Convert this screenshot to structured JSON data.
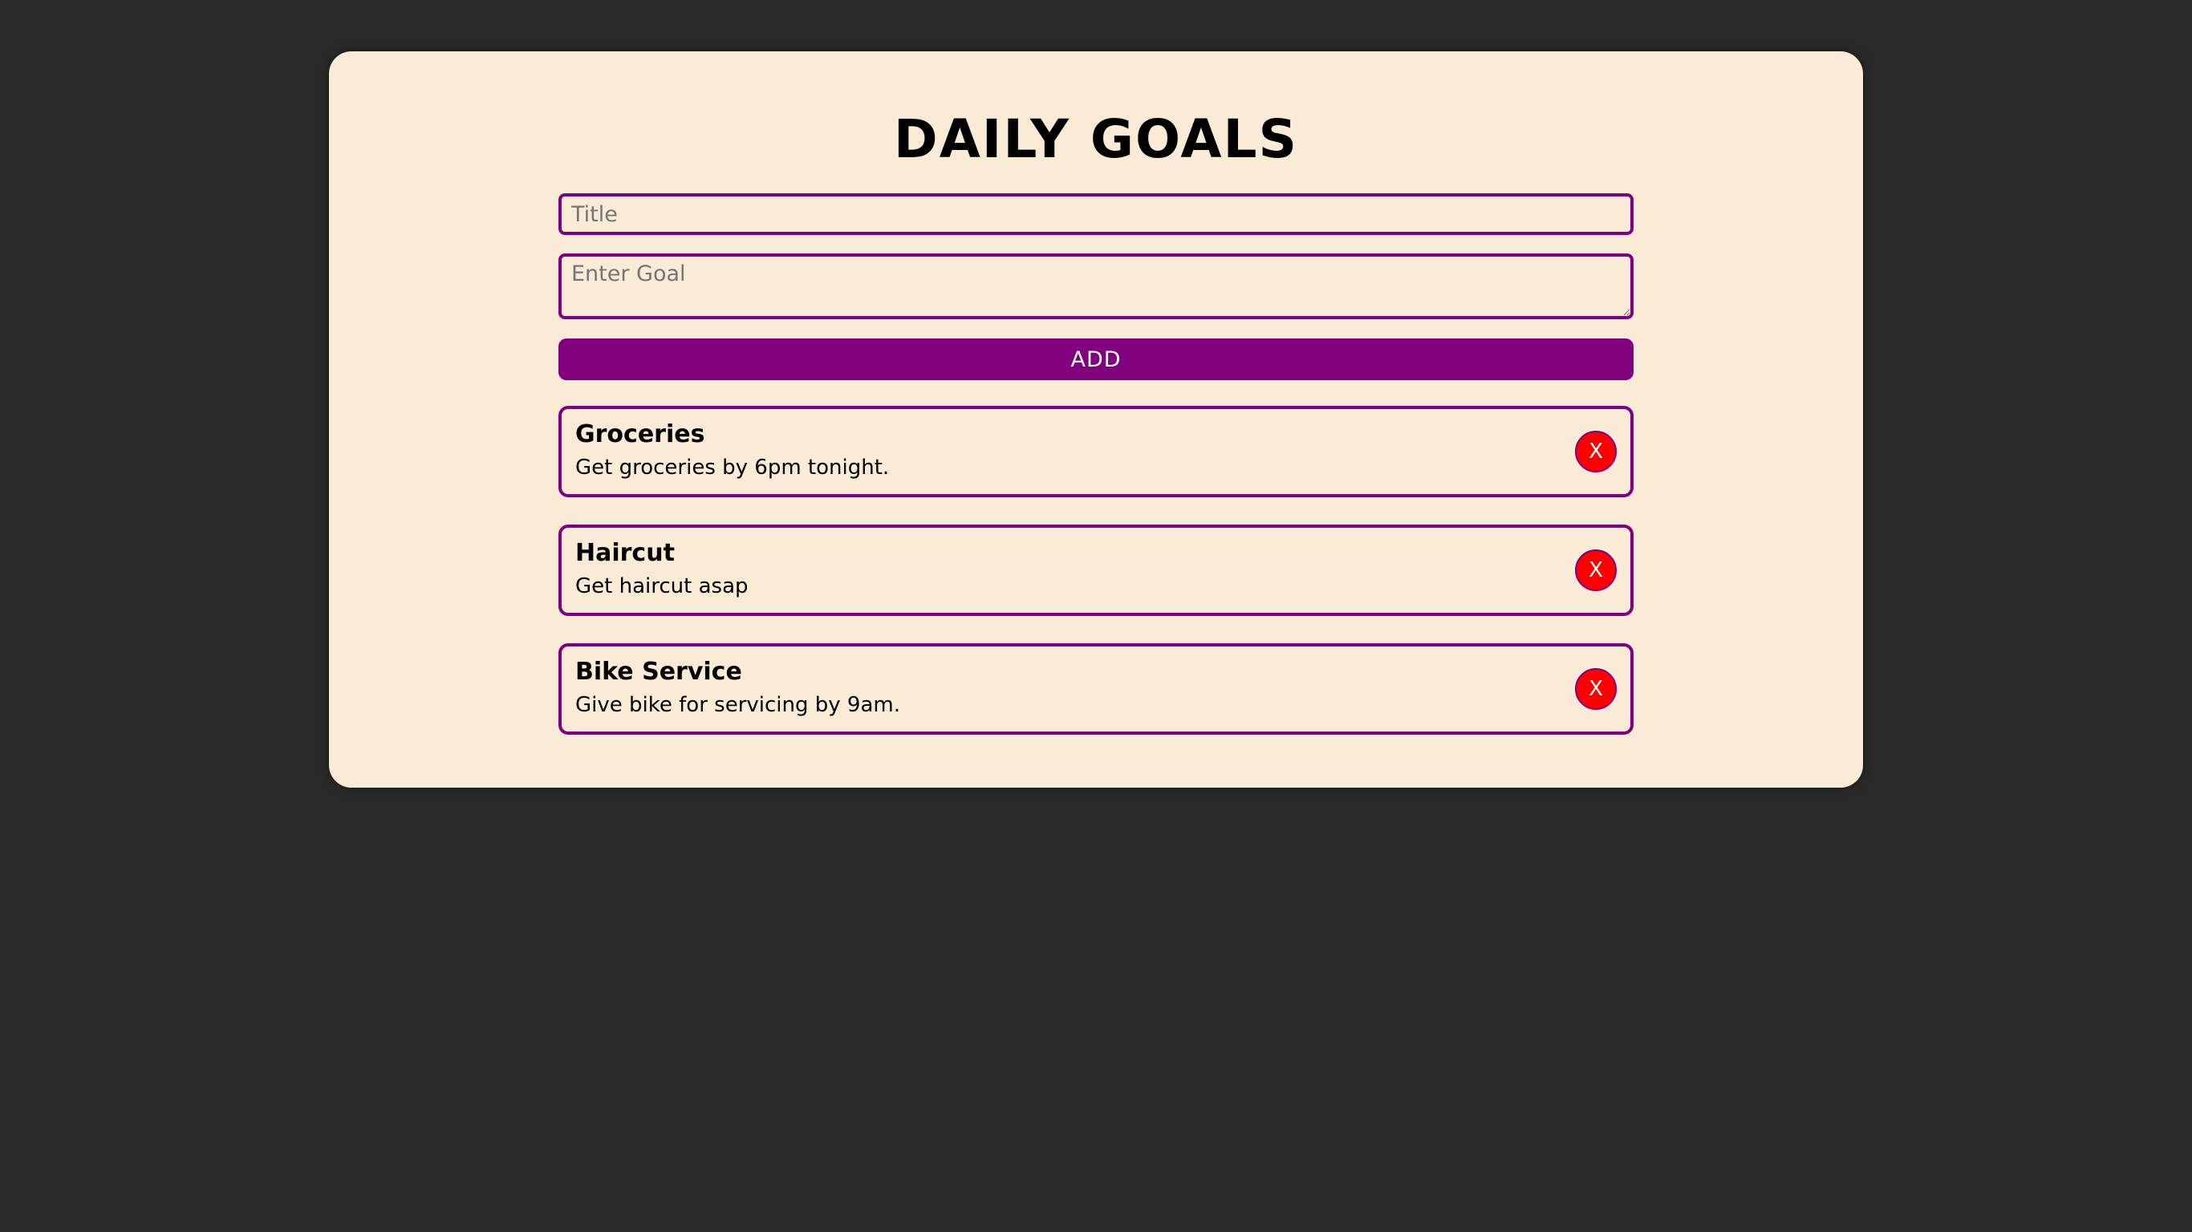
{
  "app": {
    "title": "DAILY GOALS"
  },
  "form": {
    "title_placeholder": "Title",
    "title_value": "",
    "goal_placeholder": "Enter Goal",
    "goal_value": "",
    "add_label": "ADD"
  },
  "goals": [
    {
      "title": "Groceries",
      "description": "Get groceries by 6pm tonight.",
      "delete_label": "X"
    },
    {
      "title": "Haircut",
      "description": "Get haircut asap",
      "delete_label": "X"
    },
    {
      "title": "Bike Service",
      "description": "Give bike for servicing by 9am.",
      "delete_label": "X"
    }
  ],
  "colors": {
    "background": "#2a2a2a",
    "card": "#faebd7",
    "accent": "#800080",
    "delete": "#ff0000"
  }
}
